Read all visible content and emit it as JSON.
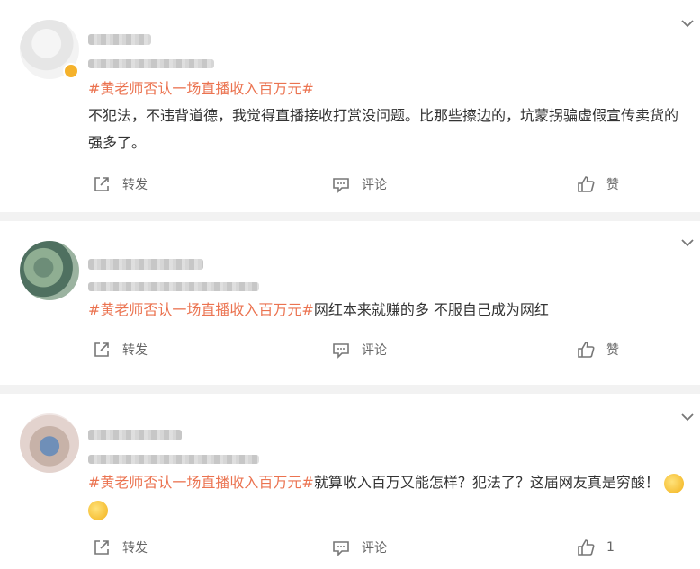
{
  "posts": [
    {
      "hashtag": "#黄老师否认一场直播收入百万元#",
      "body": "不犯法，不违背道德，我觉得直播接收打赏没问题。比那些擦边的，坑蒙拐骗虚假宣传卖货的强多了。",
      "actions": {
        "repost": "转发",
        "comment": "评论",
        "like": "赞"
      }
    },
    {
      "hashtag": "#黄老师否认一场直播收入百万元#",
      "body": "网红本来就赚的多 不服自己成为网红",
      "actions": {
        "repost": "转发",
        "comment": "评论",
        "like": "赞"
      }
    },
    {
      "hashtag": "#黄老师否认一场直播收入百万元#",
      "body": "就算收入百万又能怎样？犯法了？这届网友真是穷酸！",
      "actions": {
        "repost": "转发",
        "comment": "评论",
        "like": "1"
      }
    }
  ],
  "icons": {
    "repost": "repost-icon",
    "comment": "comment-icon",
    "like": "thumbs-up-icon",
    "expand": "chevron-down-icon",
    "emoji": "emoji-icon"
  },
  "colors": {
    "hashtag": "#eb7350",
    "divider": "#f2f2f2",
    "text": "#333333",
    "action": "#666666"
  }
}
